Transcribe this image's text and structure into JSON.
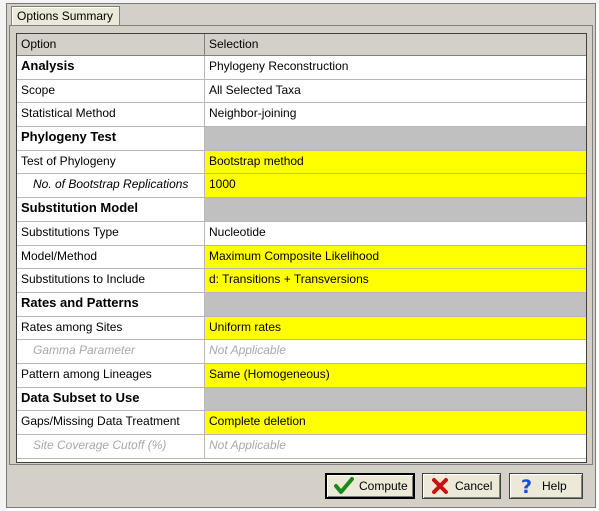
{
  "tab": {
    "label": "Options Summary"
  },
  "grid": {
    "headers": [
      "Option",
      "Selection"
    ],
    "rows": [
      {
        "option": "Analysis",
        "selection": "Phylogeny Reconstruction",
        "type": "section-white"
      },
      {
        "option": "Scope",
        "selection": "All Selected Taxa",
        "type": "normal"
      },
      {
        "option": "Statistical Method",
        "selection": "Neighbor-joining",
        "type": "normal"
      },
      {
        "option": "Phylogeny Test",
        "selection": "",
        "type": "section"
      },
      {
        "option": "Test of Phylogeny",
        "selection": "Bootstrap method",
        "type": "yellow"
      },
      {
        "option": "No. of Bootstrap Replications",
        "selection": "1000",
        "type": "yellow-indent"
      },
      {
        "option": "Substitution Model",
        "selection": "",
        "type": "section"
      },
      {
        "option": "Substitutions Type",
        "selection": "Nucleotide",
        "type": "normal"
      },
      {
        "option": "Model/Method",
        "selection": "Maximum Composite Likelihood",
        "type": "yellow"
      },
      {
        "option": "Substitutions to Include",
        "selection": "d: Transitions + Transversions",
        "type": "yellow"
      },
      {
        "option": "Rates and Patterns",
        "selection": "",
        "type": "section"
      },
      {
        "option": "Rates among Sites",
        "selection": "Uniform rates",
        "type": "yellow"
      },
      {
        "option": "Gamma Parameter",
        "selection": "Not Applicable",
        "type": "na"
      },
      {
        "option": "Pattern among Lineages",
        "selection": "Same (Homogeneous)",
        "type": "yellow"
      },
      {
        "option": "Data Subset to Use",
        "selection": "",
        "type": "section"
      },
      {
        "option": "Gaps/Missing Data Treatment",
        "selection": "Complete deletion",
        "type": "yellow"
      },
      {
        "option": "Site Coverage Cutoff (%)",
        "selection": "Not Applicable",
        "type": "na"
      }
    ]
  },
  "buttons": {
    "compute": "Compute",
    "cancel": "Cancel",
    "help": "Help"
  },
  "icons": {
    "compute": "checkmark-icon",
    "cancel": "x-icon",
    "help": "question-icon"
  },
  "colors": {
    "highlight": "#ffff00",
    "section_fill": "#c0c0c0",
    "check": "#1a8a1a",
    "cancel": "#cc1010",
    "help": "#1a4fd0"
  }
}
